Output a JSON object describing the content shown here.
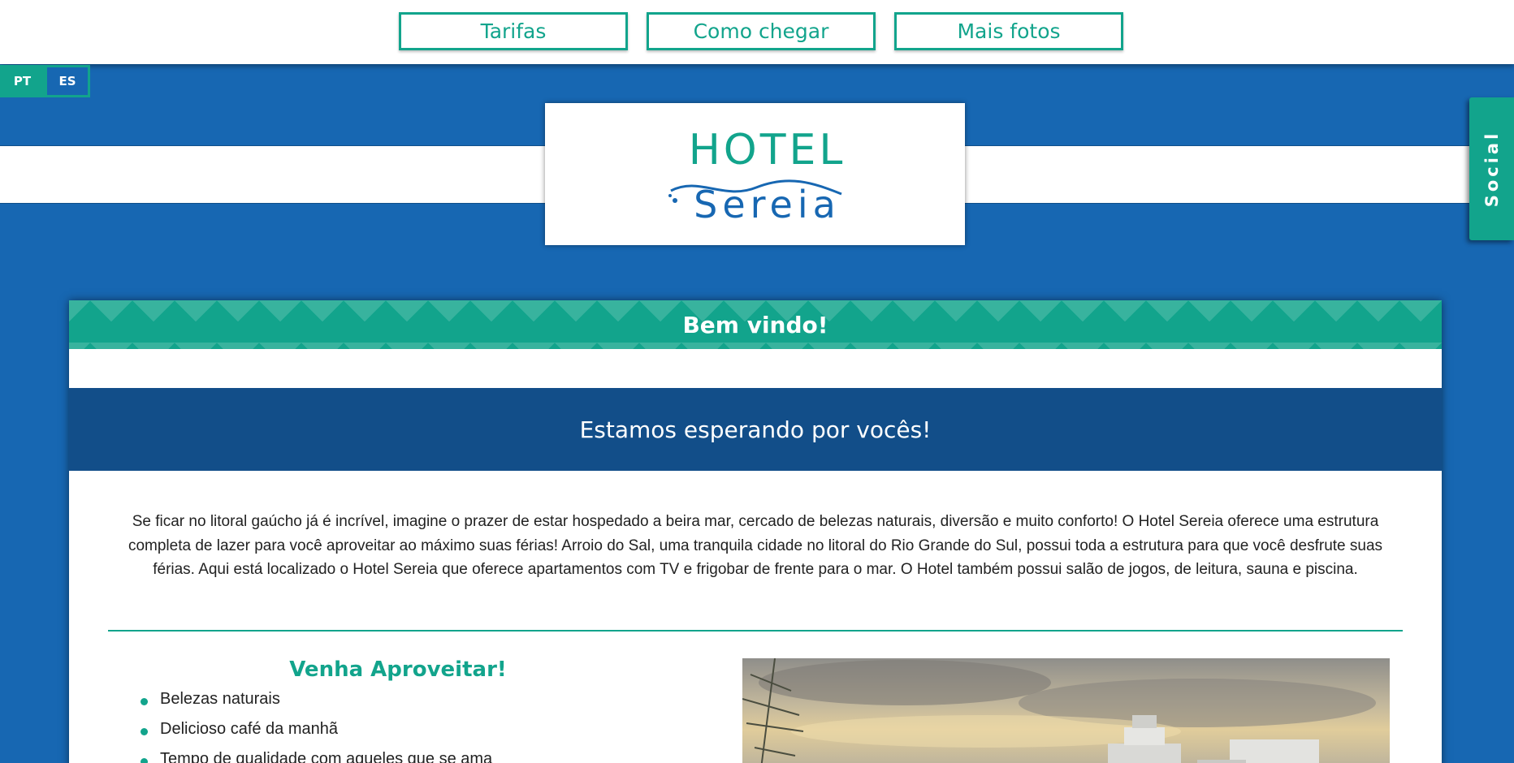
{
  "nav": {
    "tarifas": "Tarifas",
    "como_chegar": "Como chegar",
    "mais_fotos": "Mais fotos"
  },
  "lang": {
    "pt": "PT",
    "es": "ES"
  },
  "logo": {
    "line1": "HOTEL",
    "line2": "Sereia"
  },
  "social": {
    "label": "Social"
  },
  "welcome": {
    "title": "Bem vindo!"
  },
  "subheader": {
    "title": "Estamos esperando por vocês!"
  },
  "intro": {
    "text": "Se ficar no litoral gaúcho já é incrível, imagine o prazer de estar hospedado a beira mar, cercado de belezas naturais, diversão e muito conforto! O Hotel Sereia oferece uma estrutura completa de lazer para você aproveitar ao máximo suas férias! Arroio do Sal, uma tranquila cidade no litoral do Rio Grande do Sul, possui toda a estrutura para que você desfrute suas férias. Aqui está localizado o Hotel Sereia que oferece apartamentos com TV e frigobar de frente para o mar. O Hotel também possui salão de jogos, de leitura, sauna e piscina."
  },
  "venha": {
    "title": "Venha Aproveitar!",
    "items": [
      "Belezas naturais",
      "Delicioso café da manhã",
      "Tempo de qualidade com aqueles que se ama"
    ]
  },
  "colors": {
    "brand_blue": "#1767b2",
    "brand_green": "#12a48c",
    "dark_blue": "#124e89"
  }
}
